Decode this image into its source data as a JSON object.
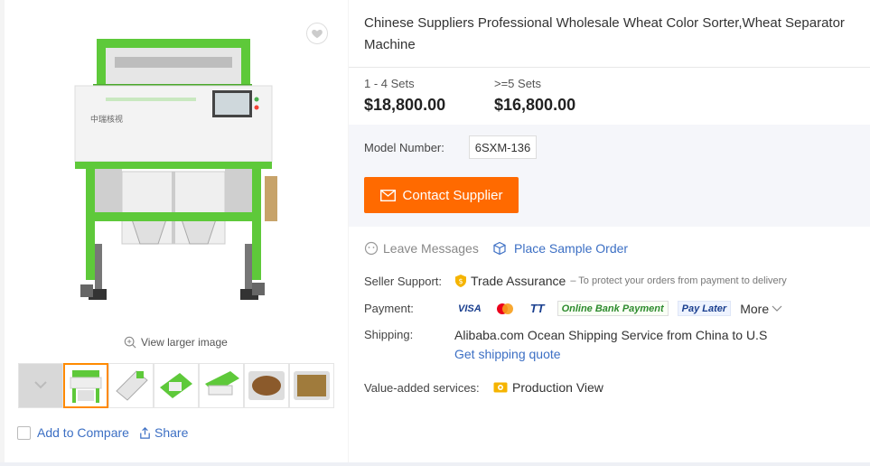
{
  "product": {
    "title": "Chinese Suppliers Professional Wholesale Wheat Color Sorter,Wheat Separator Machine",
    "view_larger": "View larger image",
    "add_compare": "Add to Compare",
    "share": "Share",
    "brand_text": "中瑞核视",
    "thumbnail_count": 7
  },
  "pricing": [
    {
      "qty": "1 - 4 Sets",
      "price": "$18,800.00"
    },
    {
      "qty": ">=5 Sets",
      "price": "$16,800.00"
    }
  ],
  "model": {
    "label": "Model Number:",
    "value": "6SXM-136"
  },
  "contact": {
    "label": "Contact Supplier"
  },
  "actions": {
    "leave_messages": "Leave Messages",
    "place_sample": "Place Sample Order"
  },
  "seller_support": {
    "label": "Seller Support:",
    "trade_assurance": "Trade Assurance",
    "note": "– To protect your orders from payment to delivery"
  },
  "payment": {
    "label": "Payment:",
    "methods": [
      "VISA",
      "",
      "TT",
      "Online Bank Payment",
      "Pay Later"
    ],
    "more": "More"
  },
  "shipping": {
    "label": "Shipping:",
    "text": "Alibaba.com Ocean Shipping Service from China to U.S",
    "link": "Get shipping quote"
  },
  "value_added": {
    "label": "Value-added services:",
    "text": "Production View"
  },
  "colors": {
    "accent": "#ff6a00",
    "link": "#3c6fc4",
    "green": "#5ec93a",
    "active_thumb": "#ff8a00"
  }
}
